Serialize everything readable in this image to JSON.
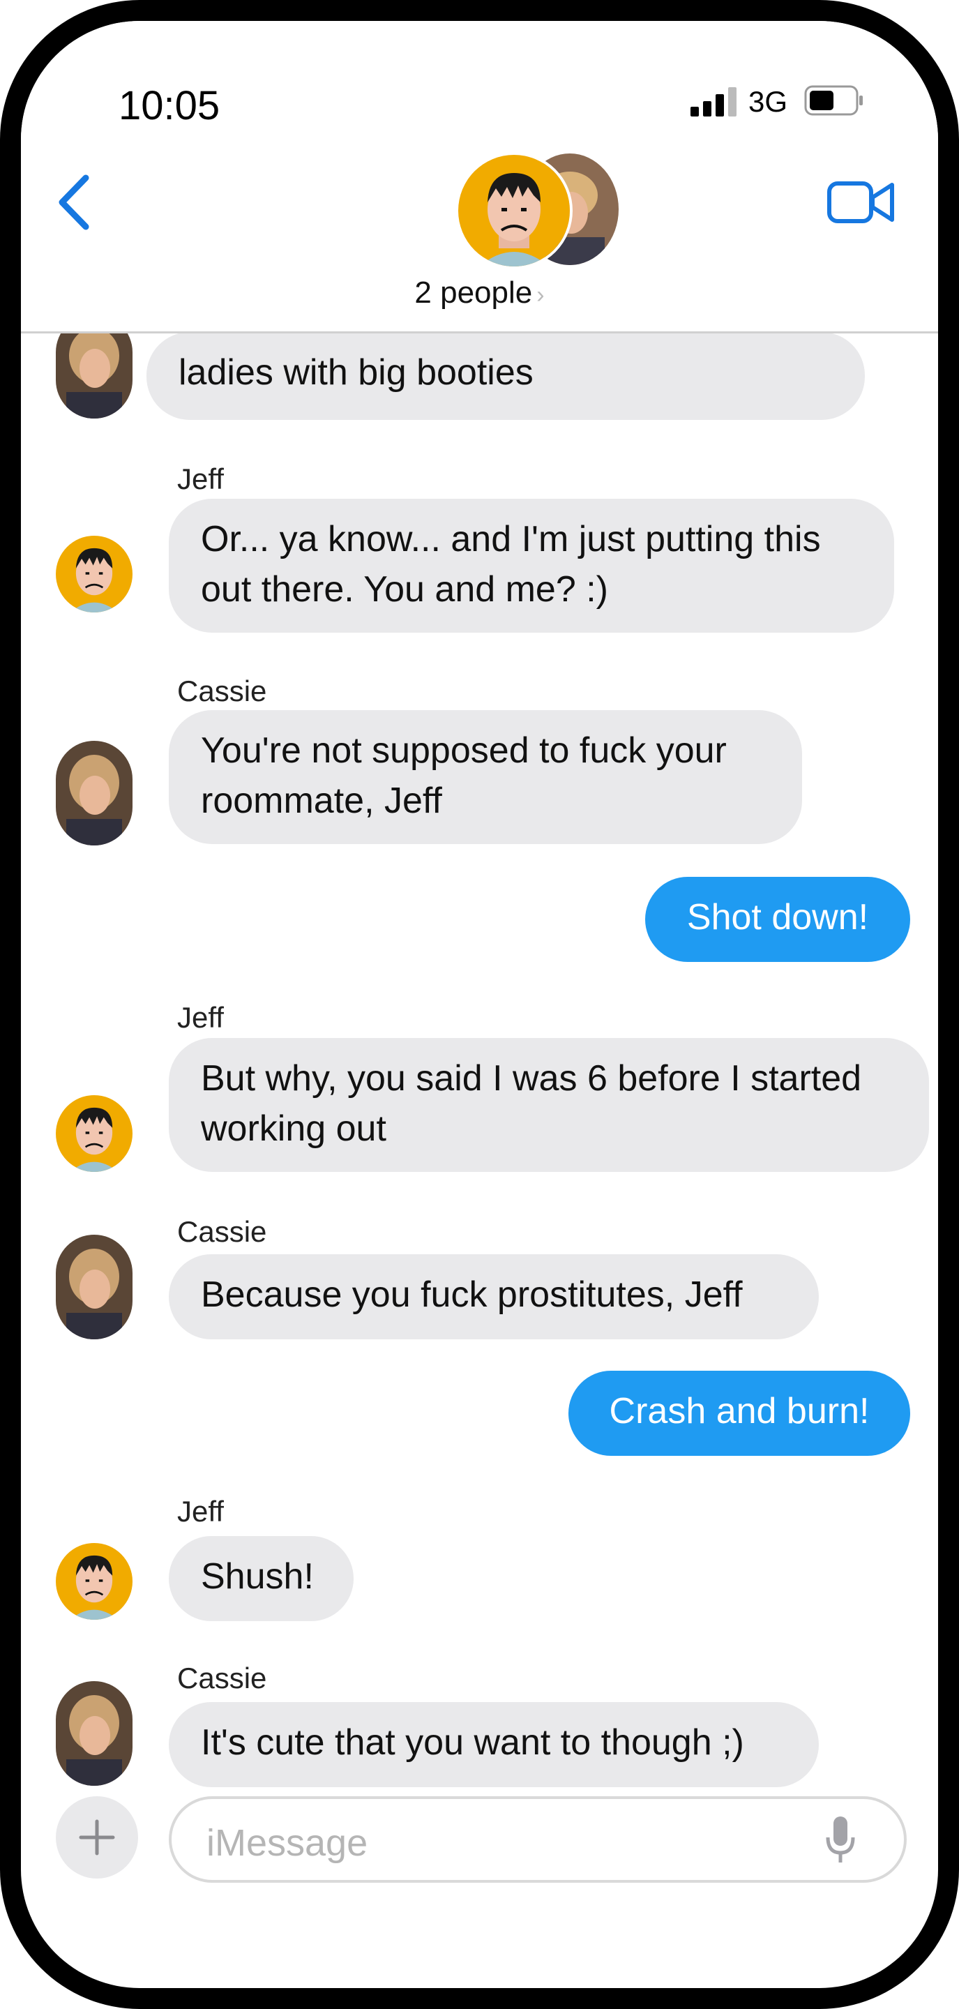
{
  "status_bar": {
    "time": "10:05",
    "network": "3G"
  },
  "header": {
    "people_label": "2 people",
    "chevron": "›"
  },
  "messages": [
    {
      "sender": "",
      "text": "ladies with big booties"
    },
    {
      "sender": "Jeff",
      "text": "Or... ya know... and I'm just putting this out there.  You and me? :)"
    },
    {
      "sender": "Cassie",
      "text": "You're not supposed to fuck your roommate, Jeff"
    },
    {
      "sender": "",
      "text": "Shot down!"
    },
    {
      "sender": "Jeff",
      "text": "But why, you said I was 6 before I started working out"
    },
    {
      "sender": "Cassie",
      "text": "Because you fuck prostitutes, Jeff"
    },
    {
      "sender": "",
      "text": "Crash and burn!"
    },
    {
      "sender": "Jeff",
      "text": "Shush!"
    },
    {
      "sender": "Cassie",
      "text": "It's cute that you want to though ;)"
    }
  ],
  "input": {
    "placeholder": "iMessage"
  },
  "icons": {
    "back": "chevron-left-icon",
    "video": "video-camera-icon",
    "add": "plus-icon",
    "mic": "microphone-icon"
  },
  "colors": {
    "accent": "#1f9bf2",
    "incoming": "#e9e9eb",
    "jeff_avatar": "#f1ab00"
  }
}
